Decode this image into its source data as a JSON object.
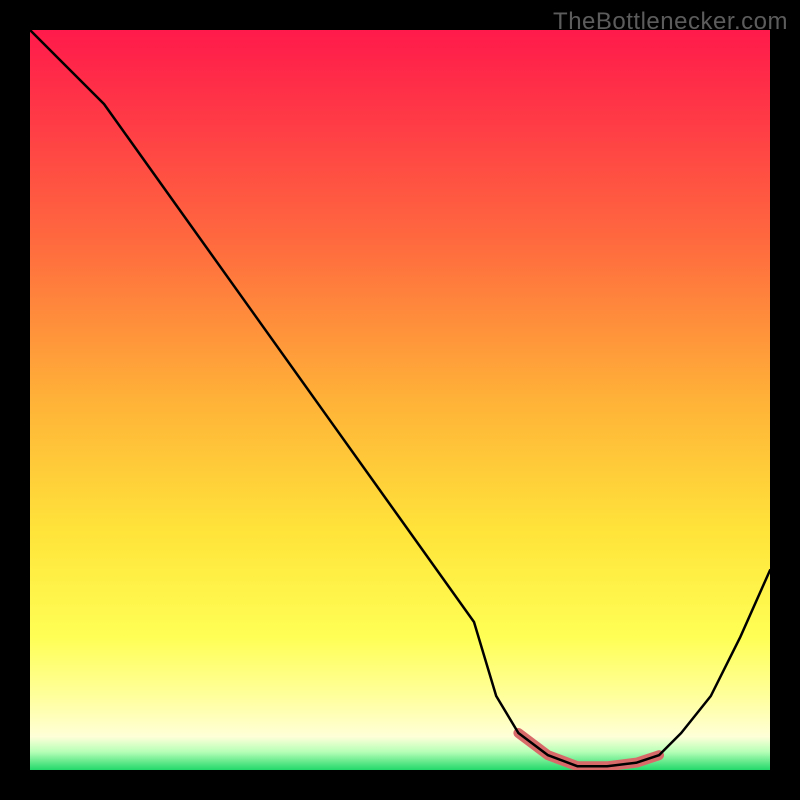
{
  "watermark": "TheBottlenecker.com",
  "chart_data": {
    "type": "line",
    "title": "",
    "xlabel": "",
    "ylabel": "",
    "xlim": [
      0,
      100
    ],
    "ylim": [
      0,
      100
    ],
    "series": [
      {
        "name": "bottleneck-curve",
        "x": [
          0,
          4,
          10,
          20,
          30,
          40,
          50,
          60,
          63,
          66,
          70,
          74,
          78,
          82,
          85,
          88,
          92,
          96,
          100
        ],
        "y": [
          100,
          96,
          90,
          76,
          62,
          48,
          34,
          20,
          10,
          5,
          2,
          0.5,
          0.5,
          1,
          2,
          5,
          10,
          18,
          27
        ]
      }
    ],
    "trough_highlight": {
      "x": [
        66,
        70,
        74,
        78,
        82,
        85
      ],
      "y": [
        5,
        2,
        0.5,
        0.5,
        1,
        2
      ]
    },
    "background_gradient_stops": [
      {
        "offset": 0.0,
        "color": "#ff1a4b"
      },
      {
        "offset": 0.12,
        "color": "#ff3a46"
      },
      {
        "offset": 0.3,
        "color": "#ff6e3e"
      },
      {
        "offset": 0.5,
        "color": "#ffb238"
      },
      {
        "offset": 0.68,
        "color": "#ffe43a"
      },
      {
        "offset": 0.82,
        "color": "#ffff55"
      },
      {
        "offset": 0.9,
        "color": "#ffff9c"
      },
      {
        "offset": 0.955,
        "color": "#ffffd8"
      },
      {
        "offset": 0.975,
        "color": "#b8ffb8"
      },
      {
        "offset": 1.0,
        "color": "#22d96b"
      }
    ]
  }
}
